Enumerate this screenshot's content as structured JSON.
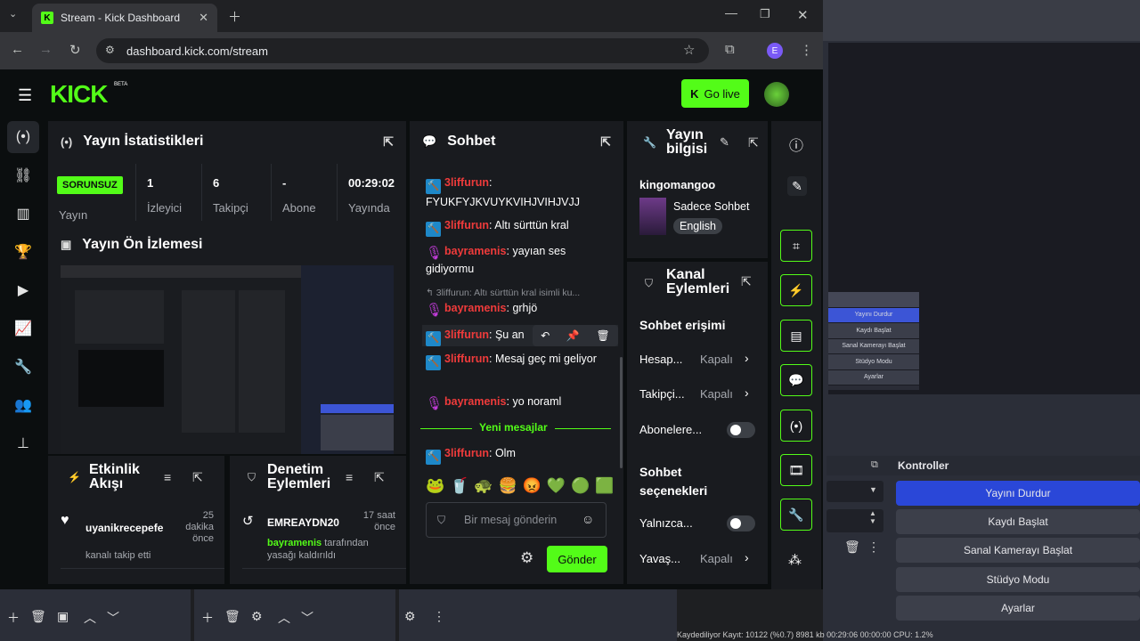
{
  "browser": {
    "tab_title": "Stream - Kick Dashboard",
    "url": "dashboard.kick.com/stream",
    "profile_initial": "E"
  },
  "kick": {
    "logo": "KICK",
    "logo_beta": "BETA",
    "go_live": "Go live"
  },
  "stats": {
    "title": "Yayın İstatistikleri",
    "status_badge": "SORUNSUZ",
    "status_label": "Yayın",
    "viewers_value": "1",
    "viewers_label": "İzleyici",
    "followers_value": "6",
    "followers_label": "Takipçi",
    "subs_value": "-",
    "subs_label": "Abone",
    "uptime_value": "00:29:02",
    "uptime_label": "Yayında"
  },
  "preview": {
    "title": "Yayın Ön İzlemesi"
  },
  "activity": {
    "title": "Etkinlik Akışı",
    "user": "uyanikrecepefe",
    "time": "25 dakika önce",
    "text": "kanalı takip etti"
  },
  "moderation": {
    "title": "Denetim Eylemleri",
    "user": "EMREAYDN20",
    "time": "17 saat önce",
    "actor": "bayramenis",
    "text": "tarafından yasağı kaldırıldı"
  },
  "chat": {
    "title": "Sohbet",
    "messages": [
      {
        "user": "3liffurun",
        "text": "FYUKFYJKVUYKVIHJVIHJVJJ"
      },
      {
        "user": "3liffurun",
        "text": "Altı sürttün kral"
      },
      {
        "user": "bayramenis",
        "text": "yayıan ses gidiyormu"
      },
      {
        "reply_preview": "3liffurun: Altı sürttün kral isimli ku..."
      },
      {
        "user": "bayramenis",
        "text": "grhjö"
      },
      {
        "user": "3liffurun",
        "text": "Şu an"
      },
      {
        "user": "3liffurun",
        "text": "Mesaj geç mi geliyor"
      },
      {
        "user": "bayramenis",
        "text": "yo noraml"
      },
      {
        "user": "3liffurun",
        "text": "Olm"
      }
    ],
    "new_messages": "Yeni mesajlar",
    "input_placeholder": "Bir mesaj gönderin",
    "send_label": "Gönder"
  },
  "stream_info": {
    "title": "Yayın bilgisi",
    "username": "kingomangoo",
    "category": "Sadece Sohbet",
    "language": "English"
  },
  "channel_actions": {
    "title": "Kanal Eylemleri",
    "chat_access": "Sohbet erişimi",
    "account_label": "Hesap...",
    "account_value": "Kapalı",
    "follower_label": "Takipçi...",
    "follower_value": "Kapalı",
    "subs_label": "Abonelere...",
    "chat_options": "Sohbet seçenekleri",
    "only_label": "Yalnızca...",
    "slow_label": "Yavaş...",
    "slow_value": "Kapalı"
  },
  "obs": {
    "menu": [
      "Yayını Durdur",
      "Kaydı Başlat",
      "Sanal Kamerayı Başlat",
      "Stüdyo Modu",
      "Ayarlar"
    ],
    "controls_title": "Kontroller",
    "buttons": [
      "Yayını Durdur",
      "Kaydı Başlat",
      "Sanal Kamerayı Başlat",
      "Stüdyo Modu",
      "Ayarlar"
    ],
    "status": "Kaydediliyor  Kayıt: 10122 (%0.7)    8981 kb    00:29:06    00:00:00   CPU: 1.2%"
  }
}
